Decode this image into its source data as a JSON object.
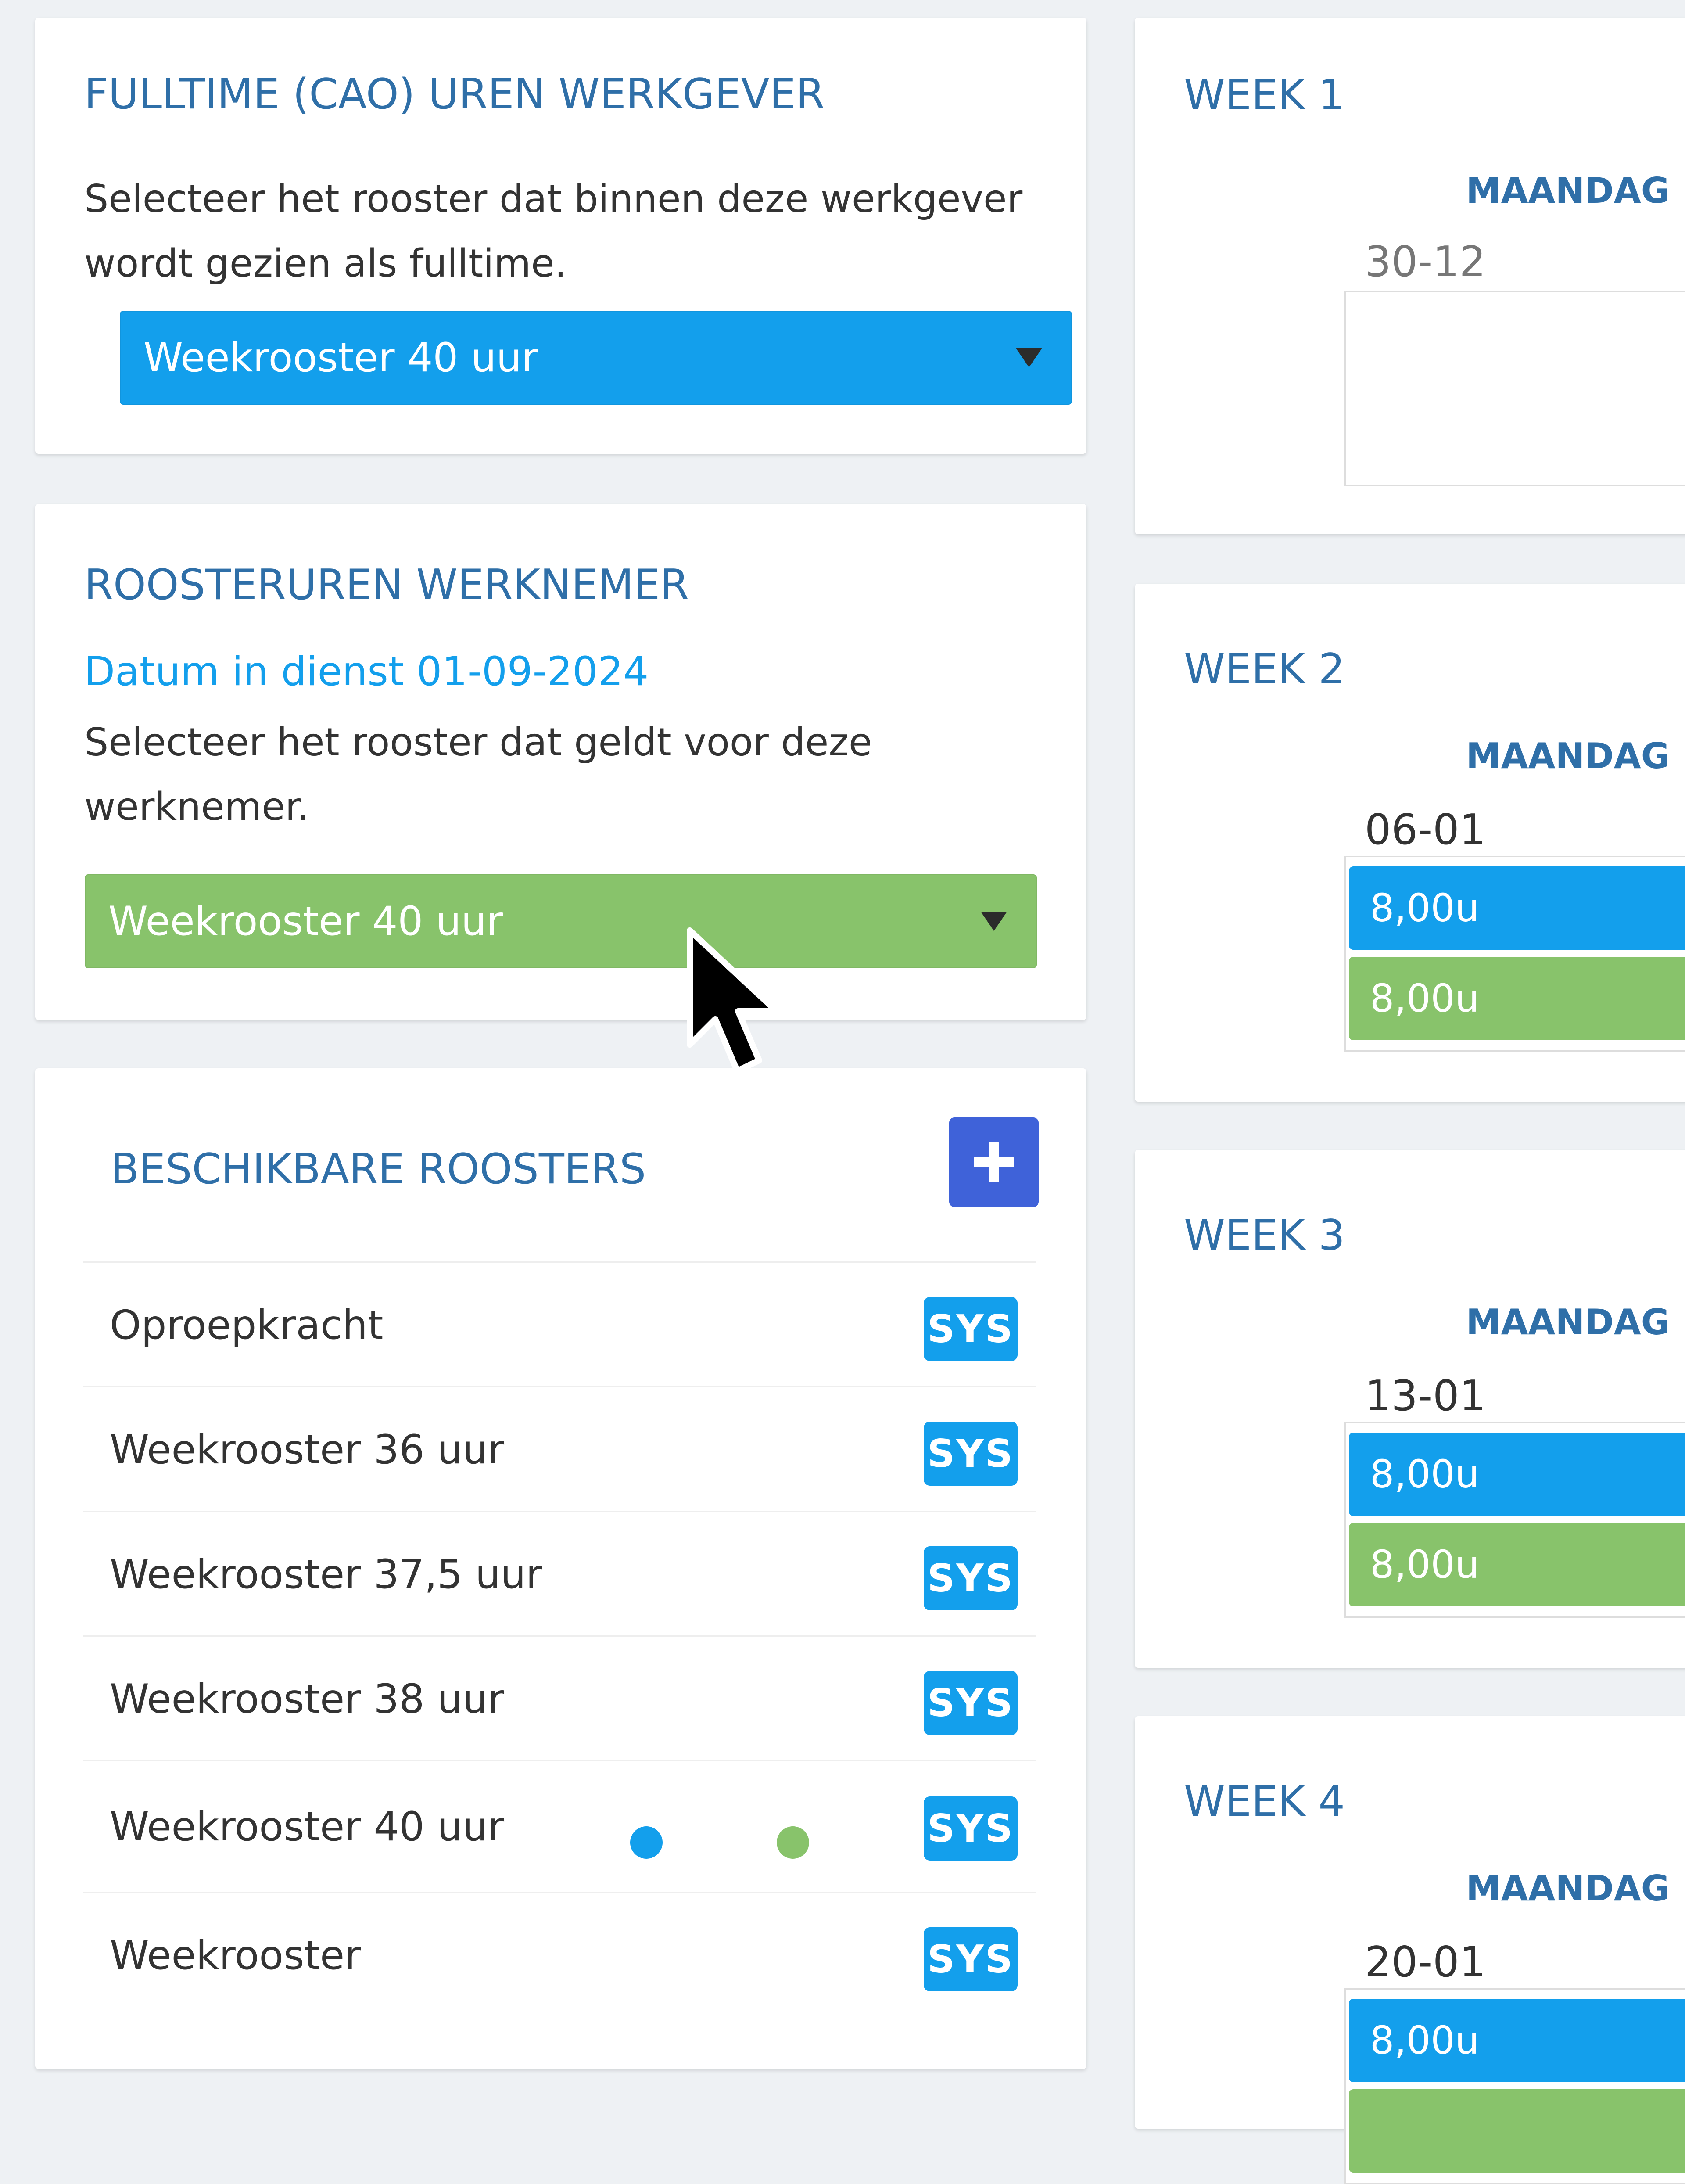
{
  "fulltime": {
    "title": "FULLTIME (CAO) UREN WERKGEVER",
    "description": "Selecteer het rooster dat binnen deze werkgever wordt gezien als fulltime.",
    "selected": "Weekrooster 40 uur"
  },
  "employee": {
    "title": "ROOSTERUREN WERKNEMER",
    "start_date_label": "Datum in dienst 01-09-2024",
    "description": "Selecteer het rooster dat geldt voor deze werknemer.",
    "selected": "Weekrooster 40 uur"
  },
  "available": {
    "title": "BESCHIKBARE ROOSTERS",
    "add_icon": "plus-icon",
    "items": [
      {
        "label": "Oproepkracht",
        "badge": "SYS"
      },
      {
        "label": "Weekrooster 36 uur",
        "badge": "SYS"
      },
      {
        "label": "Weekrooster 37,5 uur",
        "badge": "SYS"
      },
      {
        "label": "Weekrooster 38 uur",
        "badge": "SYS"
      },
      {
        "label": "Weekrooster 40 uur",
        "badge": "SYS"
      },
      {
        "label": "Weekrooster",
        "badge": "SYS"
      }
    ]
  },
  "weeks": [
    {
      "title": "WEEK 1",
      "day": "MAANDAG",
      "date": "30-12",
      "hours": []
    },
    {
      "title": "WEEK 2",
      "day": "MAANDAG",
      "date": "06-01",
      "hours": [
        "8,00u",
        "8,00u"
      ]
    },
    {
      "title": "WEEK 3",
      "day": "MAANDAG",
      "date": "13-01",
      "hours": [
        "8,00u",
        "8,00u"
      ]
    },
    {
      "title": "WEEK 4",
      "day": "MAANDAG",
      "date": "20-01",
      "hours": [
        "8,00u",
        ""
      ]
    }
  ],
  "colors": {
    "fulltime_accent": "#139fec",
    "employee_accent": "#88c36b",
    "add_button": "#3f62d9",
    "title_text": "#2f6fa8"
  }
}
